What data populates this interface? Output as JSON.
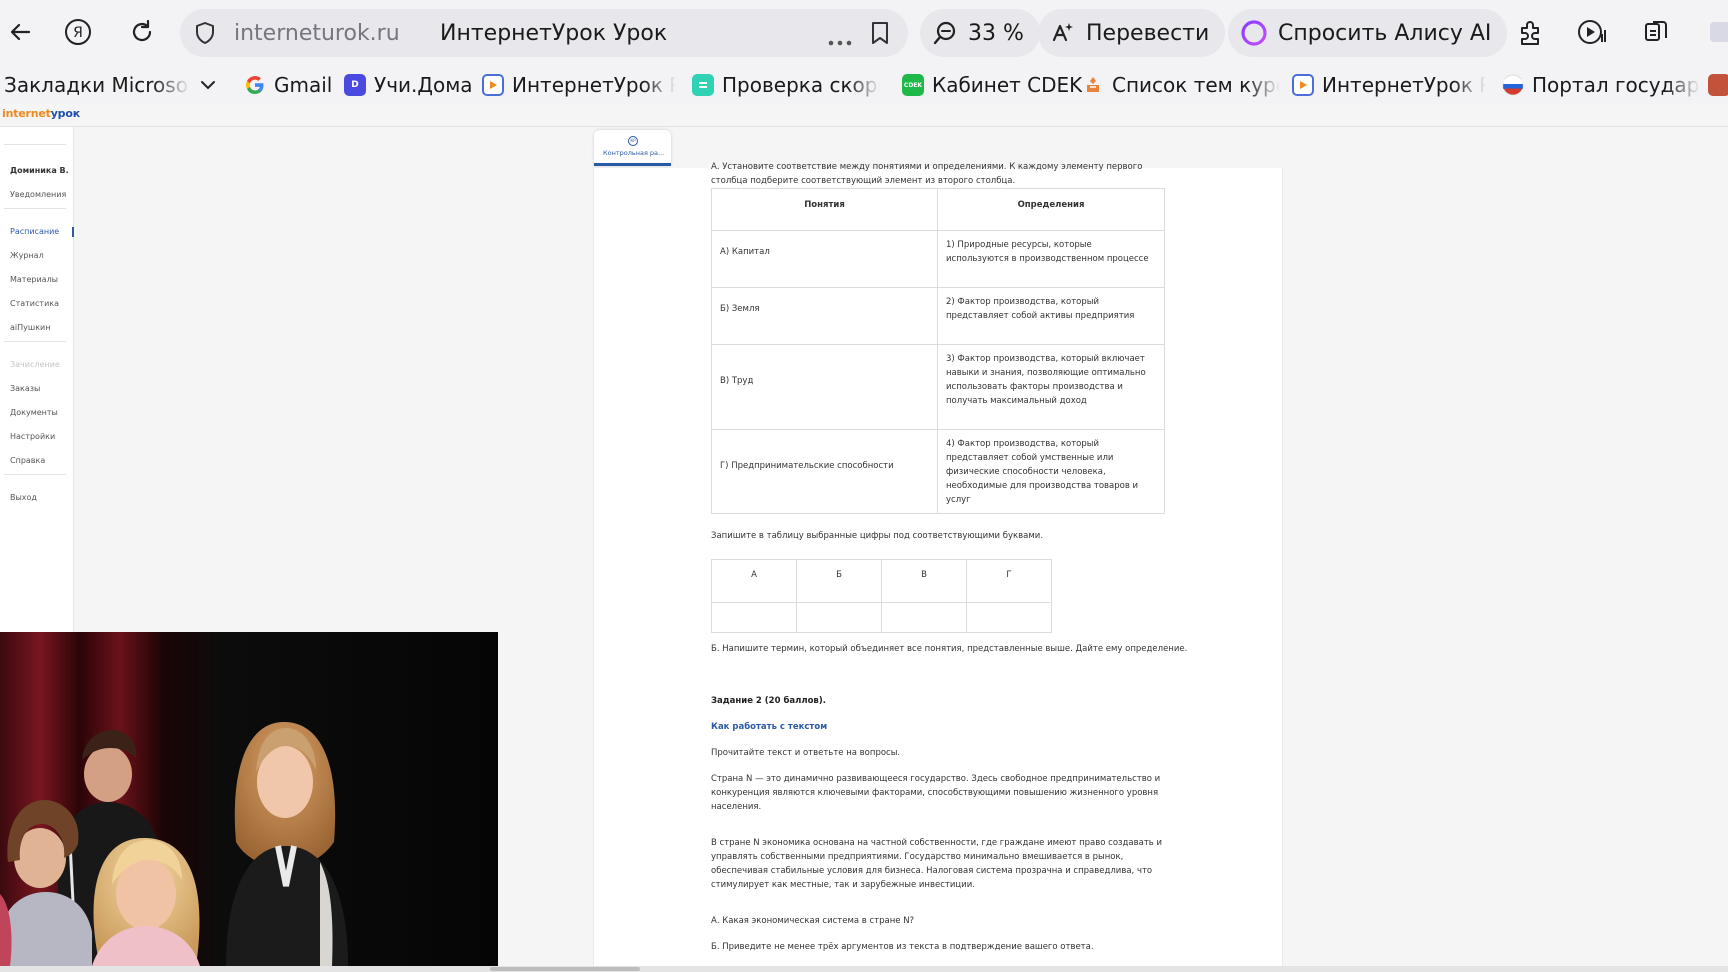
{
  "browser": {
    "url_host": "interneturok.ru",
    "page_title": "ИнтернетУрок Урок",
    "zoom_label": "33 %",
    "translate_label": "Перевести",
    "alice_label": "Спросить Алису AI",
    "icons": [
      "back-icon",
      "yandex-icon",
      "reload-icon",
      "shield-icon",
      "more-icon",
      "bookmark-icon",
      "search-icon",
      "translate-icon",
      "alice-icon",
      "extensions-icon",
      "media-icon",
      "share-icon"
    ]
  },
  "bookmarks": [
    {
      "label": "Закладки Microsoft Edge",
      "fav_color": "#ffffff"
    },
    {
      "label": "Gmail",
      "fav_color": "#ea4335"
    },
    {
      "label": "Учи.Дома",
      "fav_color": "#4a4ae0"
    },
    {
      "label": "ИнтернетУрок Ра",
      "fav_color": "#4a6fd9"
    },
    {
      "label": "Проверка скорос",
      "fav_color": "#2fd3b3"
    },
    {
      "label": "Кабинет CDEK",
      "fav_color": "#1fb94a"
    },
    {
      "label": "Список тем курса",
      "fav_color": "#e8823c"
    },
    {
      "label": "ИнтернетУрок Ра",
      "fav_color": "#4a6fd9"
    },
    {
      "label": "Портал государст",
      "fav_color": "#d43a2f"
    }
  ],
  "site": {
    "logo_part1": "internet",
    "logo_part2": "урок"
  },
  "sidebar": {
    "user": "Доминика В.",
    "items": [
      "Уведомления",
      "Расписание",
      "Журнал",
      "Материалы",
      "Статистика",
      "aiПушкин",
      "Зачисление",
      "Заказы",
      "Документы",
      "Настройки",
      "Справка",
      "Выход"
    ],
    "active": "Расписание"
  },
  "tab": {
    "label": "Контрольная ра...",
    "icon_text": "КР"
  },
  "content": {
    "task_a_intro": "А. Установите соответствие между понятиями и определениями. К каждому элементу первого столбца подберите соответствующий элемент из второго столбца.",
    "table_headers": [
      "Понятия",
      "Определения"
    ],
    "table_rows": [
      {
        "concept": "А) Капитал",
        "definition": "1) Природные ресурсы, которые используются в производственном процессе"
      },
      {
        "concept": "Б) Земля",
        "definition": "2) Фактор производства, который представляет собой активы предприятия"
      },
      {
        "concept": "В) Труд",
        "definition": "3) Фактор производства, который включает навыки и знания, позволяющие оптимально использовать факторы производства и получать максимальный доход"
      },
      {
        "concept": "Г) Предпринимательские способности",
        "definition": "4) Фактор производства, который представляет собой умственные или физические способности человека, необходимые для производства товаров и услуг"
      }
    ],
    "answer_prompt": "Запишите в таблицу выбранные цифры под соответствующими буквами.",
    "answer_letters": [
      "А",
      "Б",
      "В",
      "Г"
    ],
    "task_b": "Б. Напишите термин, который объединяет все понятия, представленные выше. Дайте ему определение.",
    "task2_title": "Задание 2 (20 баллов).",
    "how_to_link": "Как работать с текстом",
    "read_prompt": "Прочитайте текст и ответьте на вопросы.",
    "para1": "Страна N — это динамично развивающееся государство. Здесь свободное предпринимательство и конкуренция являются ключевыми факторами, способствующими повышению жизненного уровня населения.",
    "para2": "В стране N экономика основана на частной собственности, где граждане имеют право создавать и управлять собственными предприятиями. Государство минимально вмешивается в рынок, обеспечивая стабильные условия для бизнеса. Налоговая система прозрачна и справедлива, что стимулирует как местные, так и зарубежные инвестиции.",
    "q_a": "А. Какая экономическая система в стране N?",
    "q_b": "Б. Приведите не менее трёх аргументов из текста в подтверждение вашего ответа."
  }
}
